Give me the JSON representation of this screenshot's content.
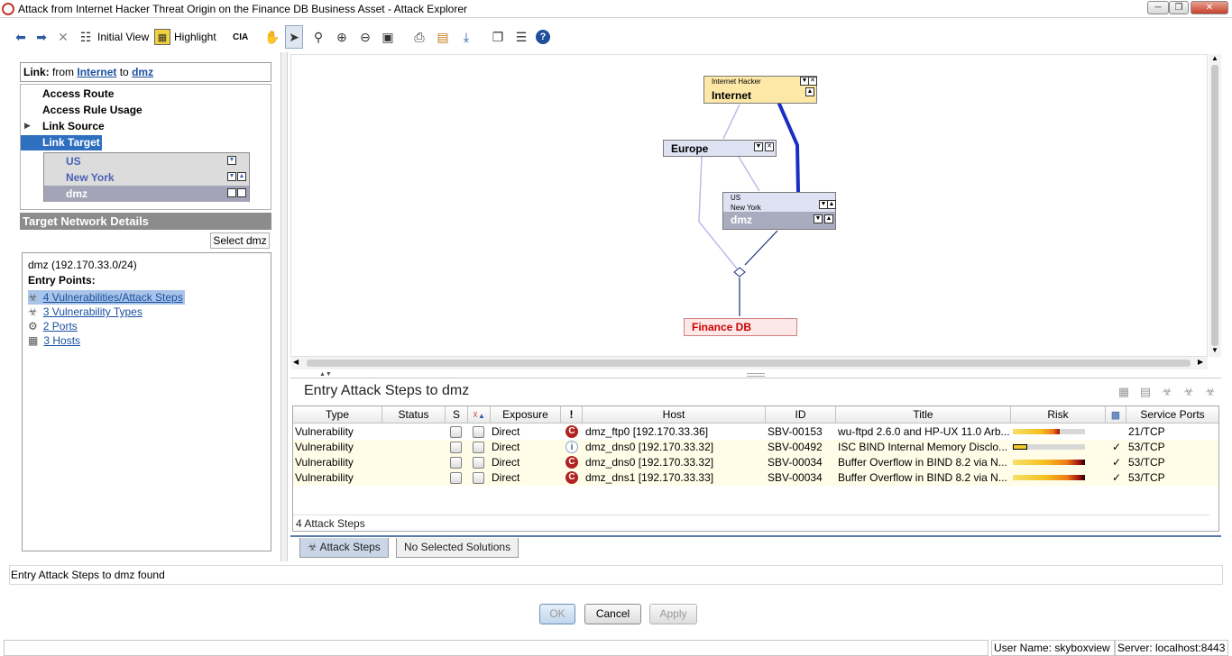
{
  "window": {
    "title": "Attack from Internet Hacker Threat Origin  on the Finance DB Business Asset - Attack Explorer"
  },
  "toolbar": {
    "initial_view_label": "Initial View",
    "highlight_label": "Highlight",
    "cia_label": "CIA"
  },
  "link_header": {
    "prefix": "Link:",
    "from_word": "from",
    "from_value": "Internet",
    "to_word": "to",
    "to_value": "dmz"
  },
  "tree": {
    "items": [
      {
        "label": "Access Route"
      },
      {
        "label": "Access Rule Usage"
      },
      {
        "label": "Link Source"
      },
      {
        "label": "Link Target"
      }
    ],
    "subnets": [
      {
        "label": "US"
      },
      {
        "label": "New York"
      },
      {
        "label": "dmz"
      }
    ]
  },
  "target_details": {
    "header": "Target Network Details",
    "select_button": "Select dmz",
    "network": "dmz (192.170.33.0/24)",
    "entry_points_label": "Entry Points:",
    "entry_points": [
      {
        "label": "4 Vulnerabilities/Attack Steps",
        "icon": "biohazard-icon"
      },
      {
        "label": "3 Vulnerability Types",
        "icon": "biohazard-types-icon"
      },
      {
        "label": "2 Ports",
        "icon": "gears-icon"
      },
      {
        "label": "3 Hosts",
        "icon": "host-icon"
      }
    ]
  },
  "graph": {
    "nodes": {
      "internet": {
        "small": "Internet Hacker",
        "big": "Internet"
      },
      "europe": {
        "big": "Europe"
      },
      "dmz": {
        "small1": "US",
        "small2": "New York",
        "big": "dmz"
      },
      "finance": {
        "big": "Finance DB"
      }
    },
    "colors": {
      "internet_fill": "#fde8a8",
      "group_fill": "#dfe2f2",
      "dmz_fill": "#a9acbf",
      "finance_fill": "#fde8e8",
      "finance_text": "#cc0000",
      "route_color": "#1a2fc0"
    }
  },
  "entry_steps": {
    "title": "Entry Attack Steps to dmz",
    "columns": [
      "Type",
      "Status",
      "S",
      "",
      "Exposure",
      "!",
      "Host",
      "ID",
      "Title",
      "Risk",
      "",
      "Service Ports"
    ],
    "rows": [
      {
        "type": "Vulnerability",
        "status": "",
        "exposure": "Direct",
        "severity": "C",
        "host": "dmz_ftp0 [192.170.33.36]",
        "id": "SBV-00153",
        "title": "wu-ftpd 2.6.0 and HP-UX 11.0 Arb...",
        "risk": 0.65,
        "checked": false,
        "port": "21/TCP"
      },
      {
        "type": "Vulnerability",
        "status": "",
        "exposure": "Direct",
        "severity": "i",
        "host": "dmz_dns0 [192.170.33.32]",
        "id": "SBV-00492",
        "title": "ISC BIND Internal Memory Disclo...",
        "risk": 0.2,
        "checked": true,
        "port": "53/TCP"
      },
      {
        "type": "Vulnerability",
        "status": "",
        "exposure": "Direct",
        "severity": "C",
        "host": "dmz_dns0 [192.170.33.32]",
        "id": "SBV-00034",
        "title": "Buffer Overflow in BIND 8.2 via N...",
        "risk": 1.0,
        "checked": true,
        "port": "53/TCP"
      },
      {
        "type": "Vulnerability",
        "status": "",
        "exposure": "Direct",
        "severity": "C",
        "host": "dmz_dns1 [192.170.33.33]",
        "id": "SBV-00034",
        "title": "Buffer Overflow in BIND 8.2 via N...",
        "risk": 1.0,
        "checked": true,
        "port": "53/TCP"
      }
    ],
    "footer": "4 Attack Steps"
  },
  "tabs": {
    "attack_steps": "Attack Steps",
    "no_solutions": "No Selected Solutions"
  },
  "status_message": "Entry Attack Steps to dmz found",
  "buttons": {
    "ok": "OK",
    "cancel": "Cancel",
    "apply": "Apply"
  },
  "statusbar": {
    "user": "User Name: skyboxview",
    "server": "Server: localhost:8443"
  }
}
